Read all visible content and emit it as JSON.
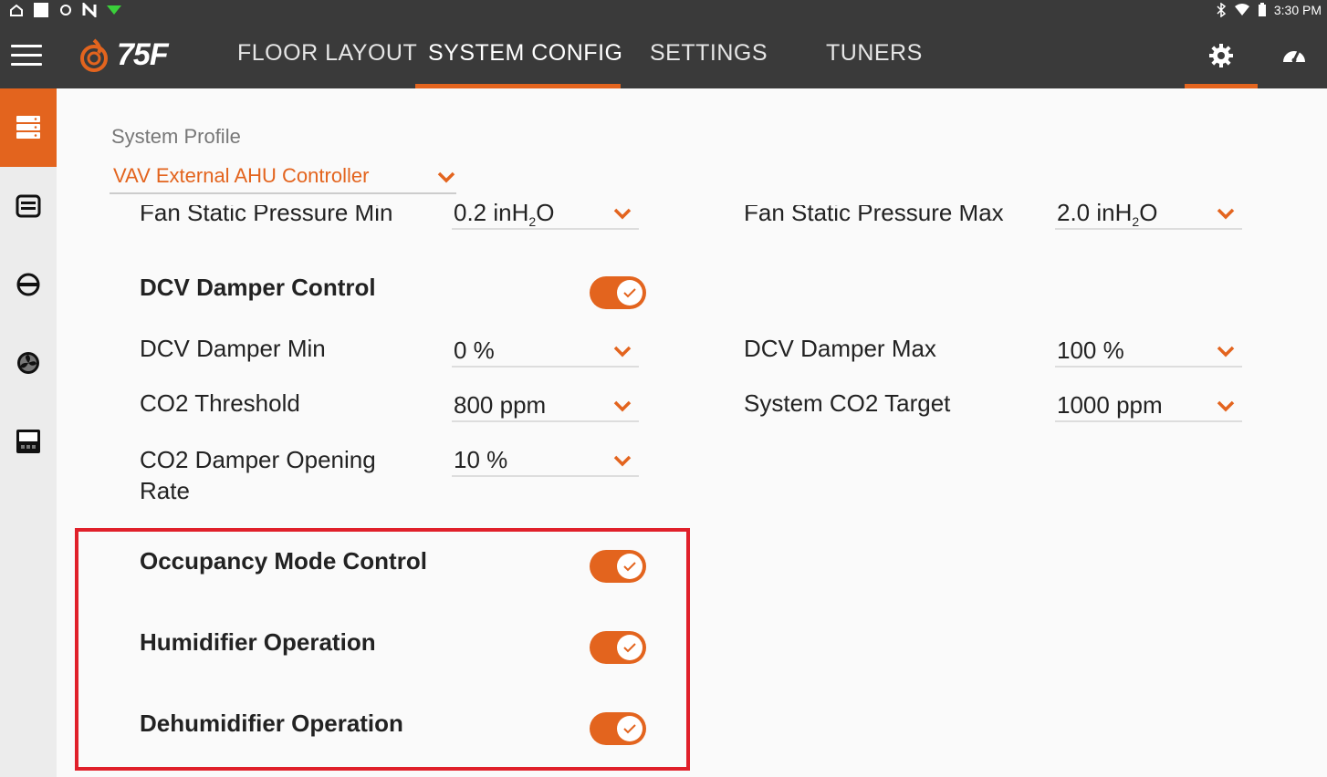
{
  "status_bar": {
    "time": "3:30 PM"
  },
  "brand": {
    "logo_text": "75F"
  },
  "nav": {
    "tabs": [
      {
        "label": "FLOOR LAYOUT",
        "active": false
      },
      {
        "label": "SYSTEM CONFIG",
        "active": true
      },
      {
        "label": "SETTINGS",
        "active": false
      },
      {
        "label": "TUNERS",
        "active": false
      }
    ]
  },
  "profile": {
    "label": "System Profile",
    "value": "VAV External AHU Controller"
  },
  "fields": {
    "fan_static_min": {
      "label": "Fan Static Pressure Min",
      "value": "0.2 inH",
      "sub": "2",
      "unit_tail": "O"
    },
    "fan_static_max": {
      "label": "Fan Static Pressure Max",
      "value": "2.0 inH",
      "sub": "2",
      "unit_tail": "O"
    },
    "dcv_damper_control": {
      "label": "DCV Damper Control",
      "enabled": true
    },
    "dcv_damper_min": {
      "label": "DCV Damper Min",
      "value": "0 %"
    },
    "dcv_damper_max": {
      "label": "DCV Damper Max",
      "value": "100 %"
    },
    "co2_threshold": {
      "label": "CO2 Threshold",
      "value": "800 ppm"
    },
    "system_co2_target": {
      "label": "System CO2 Target",
      "value": "1000 ppm"
    },
    "co2_opening_rate": {
      "label_line1": "CO2 Damper Opening",
      "label_line2": "Rate",
      "value": "10 %"
    },
    "occupancy_mode": {
      "label": "Occupancy Mode Control",
      "enabled": true
    },
    "humidifier": {
      "label": "Humidifier Operation",
      "enabled": true
    },
    "dehumidifier": {
      "label": "Dehumidifier Operation",
      "enabled": true
    }
  },
  "colors": {
    "accent": "#e3641e",
    "nav_bg": "#3a3a3a",
    "highlight": "#e0202a"
  }
}
